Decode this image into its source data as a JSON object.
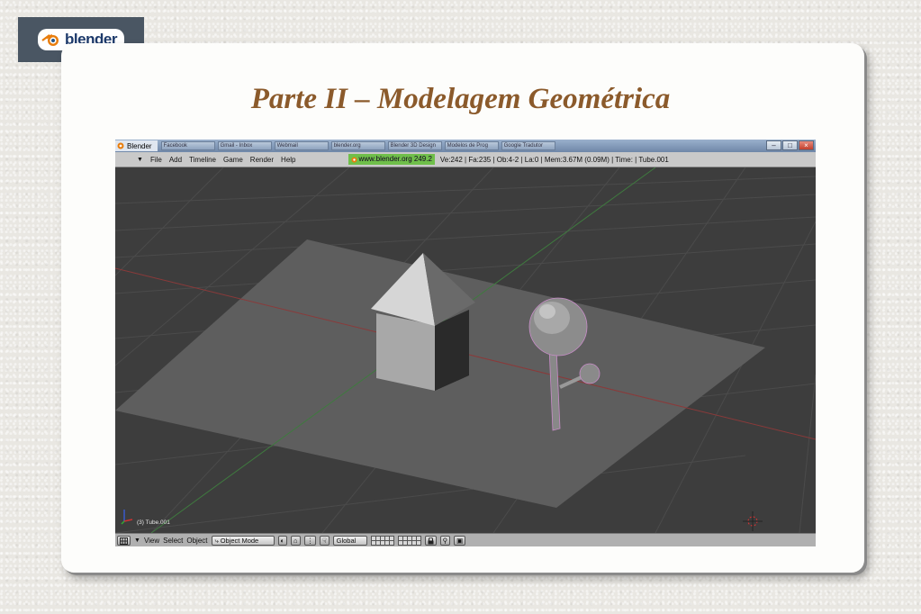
{
  "logo": {
    "text": "blender"
  },
  "slide": {
    "title": "Parte II – Modelagem Geométrica"
  },
  "window": {
    "title": "Blender",
    "taskbar_tabs": [
      "Facebook",
      "Gmail - Inbox",
      "Webmail",
      "blender.org",
      "Blender 3D Design",
      "Modelos de Prog",
      "Google Tradutor"
    ],
    "buttons": {
      "minimize": "–",
      "maximize": "□",
      "close": "×"
    }
  },
  "menu": {
    "items": [
      "File",
      "Add",
      "Timeline",
      "Game",
      "Render",
      "Help"
    ],
    "info_url": "www.blender.org 249.2",
    "info_stats": "Ve:242 | Fa:235 | Ob:4-2 | La:0  | Mem:3.67M (0.09M)  | Time: | Tube.001"
  },
  "viewport": {
    "object_label": "(3) Tube.001"
  },
  "header": {
    "items": [
      "View",
      "Select",
      "Object"
    ],
    "mode": "Object Mode",
    "orientation": "Global"
  },
  "colors": {
    "title": "#8b5a2b",
    "viewport_bg": "#3d3d3d",
    "grid": "#4a4a4a",
    "plane": "#5e5e5e",
    "x_axis": "#8a3a3a",
    "y_axis": "#3f7a3f"
  },
  "icons": [
    "blender-logo-icon",
    "view-type-icon",
    "mode-icon",
    "shading-icon",
    "pivot-icon",
    "manipulator-icon",
    "lock-icon",
    "render-icon",
    "3d-cursor-icon",
    "axis-icon"
  ]
}
